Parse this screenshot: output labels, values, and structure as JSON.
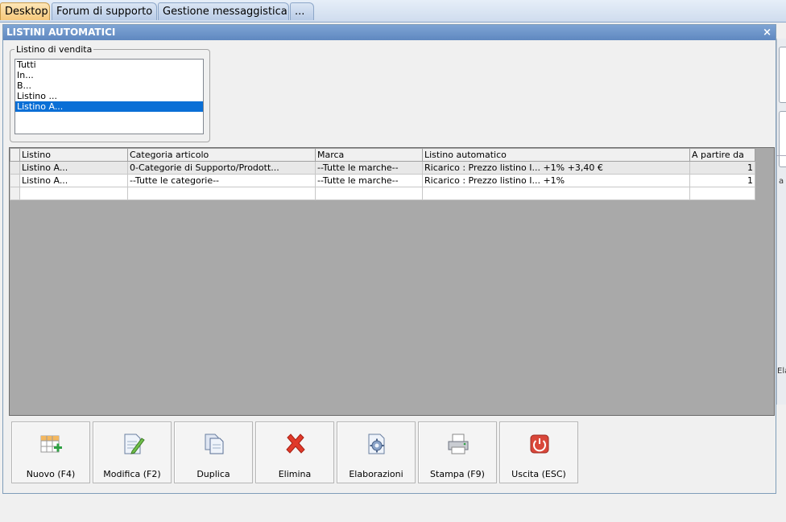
{
  "tabs": [
    {
      "label": "Desktop",
      "active": true
    },
    {
      "label": "Forum di supporto",
      "active": false
    },
    {
      "label": "Gestione messaggistica",
      "active": false
    },
    {
      "label": "...",
      "active": false
    }
  ],
  "window": {
    "title": "LISTINI AUTOMATICI",
    "close_glyph": "×"
  },
  "listino_vendita": {
    "legend": "Listino di vendita",
    "items": [
      "Tutti",
      "In...",
      "B...",
      "Listino ...",
      "Listino A..."
    ],
    "selected_index": 4
  },
  "grid": {
    "columns": [
      "Listino",
      "Categoria articolo",
      "Marca",
      "Listino automatico",
      "A partire da"
    ],
    "rows": [
      [
        "Listino A...",
        "0-Categorie di Supporto/Prodott...",
        "--Tutte le marche--",
        "Ricarico : Prezzo listino I... +1% +3,40 €",
        "1"
      ],
      [
        "Listino A...",
        "--Tutte le categorie--",
        "--Tutte le marche--",
        "Ricarico : Prezzo listino I... +1%",
        "1"
      ],
      [
        "",
        "",
        "",
        "",
        ""
      ]
    ]
  },
  "toolbar": {
    "buttons": [
      {
        "label": "Nuovo (F4)",
        "icon": "new-grid-icon"
      },
      {
        "label": "Modifica (F2)",
        "icon": "edit-document-icon"
      },
      {
        "label": "Duplica",
        "icon": "duplicate-icon"
      },
      {
        "label": "Elimina",
        "icon": "delete-x-icon"
      },
      {
        "label": "Elaborazioni",
        "icon": "process-gear-icon"
      },
      {
        "label": "Stampa (F9)",
        "icon": "printer-icon"
      },
      {
        "label": "Uscita (ESC)",
        "icon": "power-exit-icon"
      }
    ]
  },
  "background_window": {
    "fragment1": "a",
    "fragment2": "Ela"
  },
  "colors": {
    "accent": "#0a6fd6",
    "title_bar": "#6d94c8",
    "grid_background": "#a9a9a9",
    "delete_red": "#e03a2a",
    "exit_red": "#d9473a"
  }
}
